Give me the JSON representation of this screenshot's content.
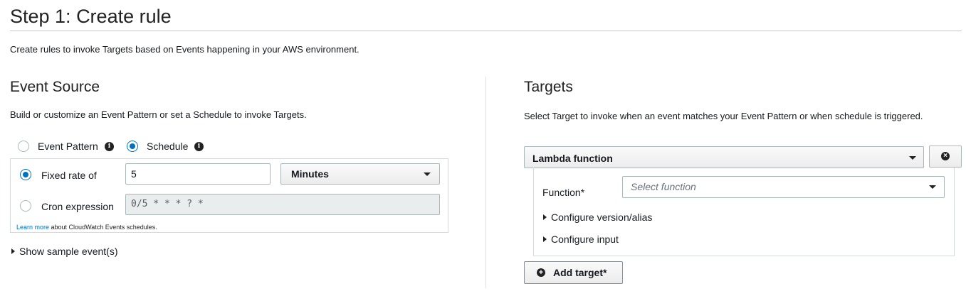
{
  "page": {
    "title": "Step 1: Create rule",
    "description": "Create rules to invoke Targets based on Events happening in your AWS environment."
  },
  "event_source": {
    "title": "Event Source",
    "description": "Build or customize an Event Pattern or set a Schedule to invoke Targets.",
    "mode_options": [
      {
        "label": "Event Pattern",
        "selected": false,
        "icon": "info-icon"
      },
      {
        "label": "Schedule",
        "selected": true,
        "icon": "info-icon"
      }
    ],
    "schedule": {
      "fixed_rate": {
        "label": "Fixed rate of",
        "selected": true,
        "value": "5",
        "unit": "Minutes"
      },
      "cron": {
        "label": "Cron expression",
        "selected": false,
        "value": "0/5 * * * ? *"
      },
      "learn_more_link": "Learn more",
      "learn_more_suffix": " about CloudWatch Events schedules."
    },
    "show_sample": "Show sample event(s)"
  },
  "targets": {
    "title": "Targets",
    "description": "Select Target to invoke when an event matches your Event Pattern or when schedule is triggered.",
    "target_type": "Lambda function",
    "function_label": "Function*",
    "function_placeholder": "Select function",
    "configure_version": "Configure version/alias",
    "configure_input": "Configure input",
    "add_target": "Add target*"
  },
  "colors": {
    "accent": "#0073bb",
    "text": "#16191f",
    "border": "#aab7b8"
  }
}
